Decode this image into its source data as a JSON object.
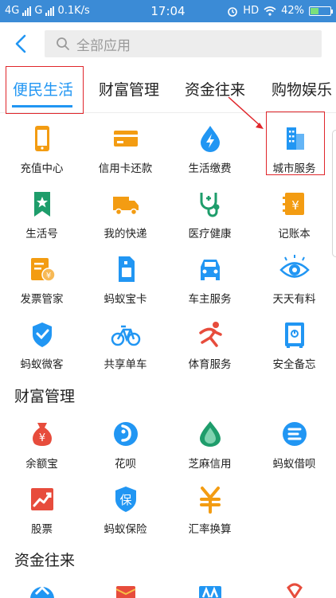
{
  "statusbar": {
    "network1": "4G",
    "network2": "G",
    "speed": "0.1K/s",
    "time": "17:04",
    "hd": "HD",
    "battery": "42%",
    "battery_level": 0.42
  },
  "search": {
    "placeholder": "全部应用"
  },
  "tabs": [
    {
      "label": "便民生活"
    },
    {
      "label": "财富管理"
    },
    {
      "label": "资金往来"
    },
    {
      "label": "购物娱乐"
    }
  ],
  "sections": {
    "wealth": "财富管理",
    "funds": "资金往来"
  },
  "items": [
    {
      "label": "充值中心"
    },
    {
      "label": "信用卡还款"
    },
    {
      "label": "生活缴费"
    },
    {
      "label": "城市服务"
    },
    {
      "label": "生活号"
    },
    {
      "label": "我的快递"
    },
    {
      "label": "医疗健康"
    },
    {
      "label": "记账本"
    },
    {
      "label": "发票管家"
    },
    {
      "label": "蚂蚁宝卡"
    },
    {
      "label": "车主服务"
    },
    {
      "label": "天天有料"
    },
    {
      "label": "蚂蚁微客"
    },
    {
      "label": "共享单车"
    },
    {
      "label": "体育服务"
    },
    {
      "label": "安全备忘"
    }
  ],
  "wealth_items": [
    {
      "label": "余额宝"
    },
    {
      "label": "花呗"
    },
    {
      "label": "芝麻信用"
    },
    {
      "label": "蚂蚁借呗"
    },
    {
      "label": "股票"
    },
    {
      "label": "蚂蚁保险"
    },
    {
      "label": "汇率换算"
    }
  ],
  "icon_glyphs": {
    "yen": "¥",
    "bao": "保"
  },
  "colors": {
    "accent": "#2196f3",
    "orange": "#f39c12",
    "green": "#1e9d6b",
    "red": "#e74c3c",
    "highlight": "#e0262b"
  }
}
